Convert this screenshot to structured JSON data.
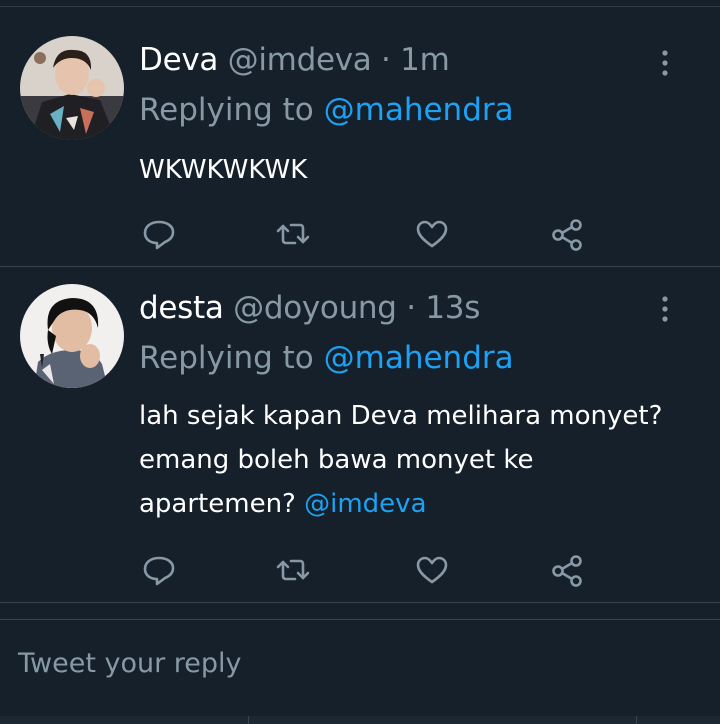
{
  "tweets": [
    {
      "name": "Deva",
      "handle": "@imdeva",
      "separator": "·",
      "time": "1m",
      "replying_prefix": "Replying to",
      "replying_to": "@mahendra",
      "text": "WKWKWKWK",
      "mention": ""
    },
    {
      "name": "desta",
      "handle": "@doyoung",
      "separator": "·",
      "time": "13s",
      "replying_prefix": "Replying to",
      "replying_to": "@mahendra",
      "text": "lah sejak kapan Deva melihara monyet? emang boleh bawa monyet ke apartemen? ",
      "mention": "@imdeva"
    }
  ],
  "icons": [
    "more-vertical-icon",
    "reply-icon",
    "retweet-icon",
    "like-icon",
    "share-icon"
  ],
  "composer": {
    "placeholder": "Tweet your reply"
  },
  "colors": {
    "background": "#15202b",
    "divider": "#38444d",
    "secondary_text": "#8899a6",
    "link": "#1da1f2",
    "primary_text": "#ffffff"
  }
}
